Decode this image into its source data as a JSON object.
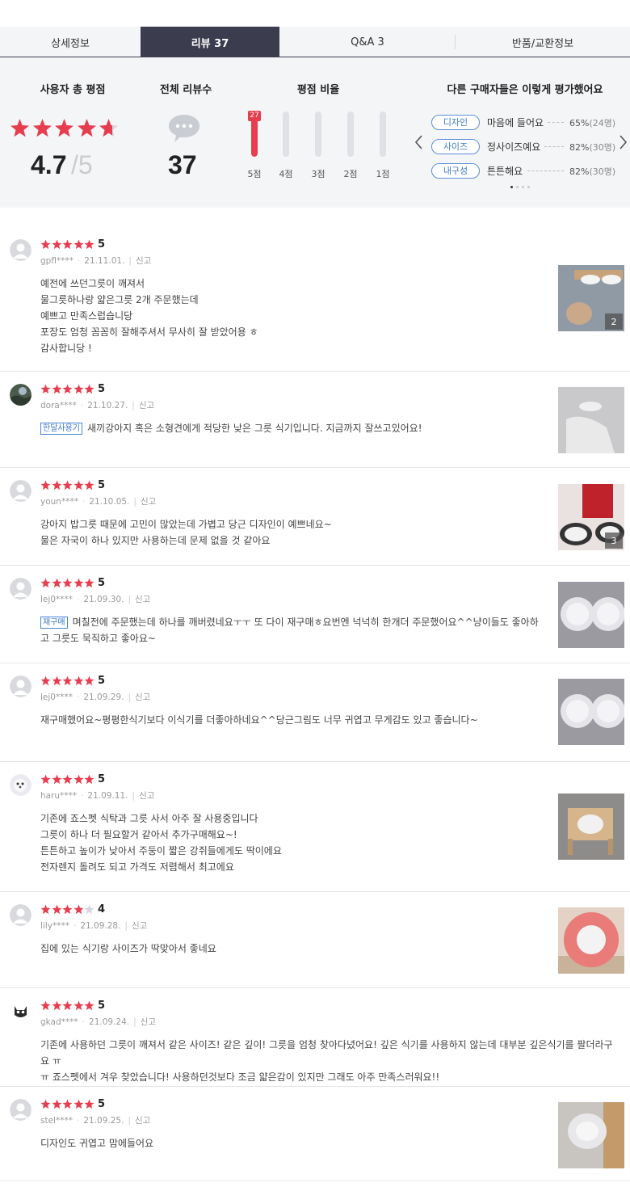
{
  "tabs": [
    {
      "label": "상세정보"
    },
    {
      "label": "리뷰 37"
    },
    {
      "label": "Q&A 3"
    },
    {
      "label": "반품/교환정보"
    }
  ],
  "summary": {
    "rating_title": "사용자 총 평점",
    "average": "4.7",
    "max": "/5",
    "average_value": 4.7,
    "total_title": "전체 리뷰수",
    "total": "37",
    "ratio_title": "평점 비율",
    "bars": [
      {
        "label": "5점",
        "count": "27",
        "fraction": 1.0
      },
      {
        "label": "4점",
        "fraction": 0.0
      },
      {
        "label": "3점",
        "fraction": 0.0
      },
      {
        "label": "2점",
        "fraction": 0.0
      },
      {
        "label": "1점",
        "fraction": 0.0
      }
    ],
    "eval_title": "다른 구매자들은 이렇게 평가했어요",
    "evals": [
      {
        "tag": "디자인",
        "answer": "마음에 들어요",
        "pct": "65%",
        "count": "(24명)"
      },
      {
        "tag": "사이즈",
        "answer": "정사이즈예요",
        "pct": "82%",
        "count": "(30명)"
      },
      {
        "tag": "내구성",
        "answer": "튼튼해요",
        "pct": "82%",
        "count": "(30명)"
      }
    ],
    "prev_icon": "chevron-left-icon",
    "next_icon": "chevron-right-icon"
  },
  "colors": {
    "accent": "#e63e4e",
    "dark_tab": "#3b3d4e",
    "tag_blue": "#3d78c9",
    "summary_bg": "#f4f5f7"
  },
  "reviews": [
    {
      "score": "5",
      "rating": 5,
      "user": "gpfl****",
      "date": "21.11.01.",
      "report": "신고",
      "tag": "",
      "lines": [
        "예전에 쓰던그릇이 깨져서",
        "물그릇하나랑 얇은그릇 2개 주문했는데",
        "예쁘고 만족스럽습니당",
        "포장도 엄청 꼼꼼히 잘해주셔서 무사히 잘 받았어용 ㅎ",
        "감사합니당 !"
      ],
      "photo_count": "2"
    },
    {
      "score": "5",
      "rating": 5,
      "user": "dora****",
      "date": "21.10.27.",
      "report": "신고",
      "tag": "한달사용기",
      "lines": [
        "새끼강아지 혹은 소형견에게 적당한 낮은 그릇 식기입니다. 지금까지 잘쓰고있어요!"
      ],
      "photo_count": ""
    },
    {
      "score": "5",
      "rating": 5,
      "user": "youn****",
      "date": "21.10.05.",
      "report": "신고",
      "tag": "",
      "lines": [
        "강아지 밥그릇 때문에 고민이 많았는데 가볍고 당근 디자인이 예쁘네요~",
        "물은 자국이 하나 있지만 사용하는데 문제 없을 것 같아요"
      ],
      "photo_count": "3"
    },
    {
      "score": "5",
      "rating": 5,
      "user": "lej0****",
      "date": "21.09.30.",
      "report": "신고",
      "tag": "재구매",
      "lines": [
        "며칠전에 주문했는데 하나를 깨버렸네요ㅜㅜ 또 다이 재구매ㅎ요번엔 넉넉히 한개더 주문했어요^^냥이들도 좋아하",
        "고 그릇도 묵직하고 좋아요~"
      ],
      "photo_count": ""
    },
    {
      "score": "5",
      "rating": 5,
      "user": "lej0****",
      "date": "21.09.29.",
      "report": "신고",
      "tag": "",
      "lines": [
        "재구매했어요~평평한식기보다 이식기를 더좋아하네요^^당근그림도 너무 귀엽고 무게감도 있고 좋습니다~"
      ],
      "photo_count": ""
    },
    {
      "score": "5",
      "rating": 5,
      "user": "haru****",
      "date": "21.09.11.",
      "report": "신고",
      "tag": "",
      "lines": [
        "기존에 죠스펫 식탁과 그릇 사서 아주 잘 사용중입니다",
        "그릇이 하나 더 필요할거 같아서 추가구매해요~!",
        "튼튼하고 높이가 낮아서 주둥이 짧은 강쥐들에게도 딱이에요",
        "전자렌지 돌려도 되고 가격도 저렴해서 최고에요"
      ],
      "photo_count": ""
    },
    {
      "score": "4",
      "rating": 4,
      "user": "lily****",
      "date": "21.09.28.",
      "report": "신고",
      "tag": "",
      "lines": [
        "집에 있는 식기랑 사이즈가 딱맞아서 좋네요"
      ],
      "photo_count": ""
    },
    {
      "score": "5",
      "rating": 5,
      "user": "gkad****",
      "date": "21.09.24.",
      "report": "신고",
      "tag": "",
      "lines": [
        "기존에 사용하던 그릇이 깨져서 같은 사이즈! 같은 깊이! 그릇을 엄청 찾아다녔어요! 깊은 식기를 사용하지 않는데 대부분 깊은식기를 팔더라구요 ㅠ",
        "ㅠ 죠스펫에서 겨우 찾았습니다! 사용하던것보다 조금 얇은감이 있지만 그래도 아주 만족스러워요!!"
      ],
      "photo_count": ""
    },
    {
      "score": "5",
      "rating": 5,
      "user": "stel****",
      "date": "21.09.25.",
      "report": "신고",
      "tag": "",
      "lines": [
        "디자인도 귀엽고 맘에들어요"
      ],
      "photo_count": ""
    }
  ]
}
